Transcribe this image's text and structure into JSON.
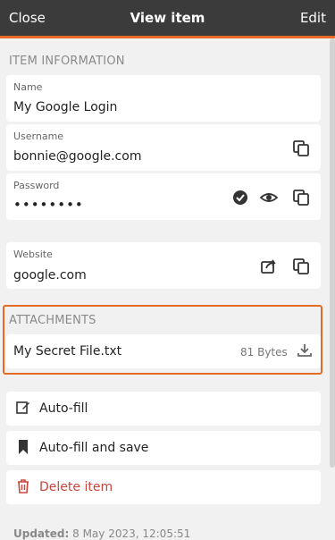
{
  "header": {
    "close_label": "Close",
    "title": "View item",
    "edit_label": "Edit"
  },
  "item_info": {
    "heading": "ITEM INFORMATION",
    "name": {
      "label": "Name",
      "value": "My Google Login"
    },
    "username": {
      "label": "Username",
      "value": "bonnie@google.com"
    },
    "password": {
      "label": "Password",
      "value": "••••••••"
    },
    "website": {
      "label": "Website",
      "value": "google.com"
    }
  },
  "attachments": {
    "heading": "ATTACHMENTS",
    "items": [
      {
        "name": "My Secret File.txt",
        "size": "81 Bytes"
      }
    ]
  },
  "actions": {
    "autofill": "Auto-fill",
    "autofill_save": "Auto-fill and save",
    "delete": "Delete item"
  },
  "footer": {
    "updated_label": "Updated:",
    "updated_value": "8 May 2023, 12:05:51"
  },
  "colors": {
    "accent": "#e56a26",
    "danger": "#c9463d",
    "header_bg": "#3b3b3b"
  },
  "icons": [
    "copy-icon",
    "check-circle-icon",
    "eye-icon",
    "share-icon",
    "download-icon",
    "edit-icon",
    "bookmark-icon",
    "trash-icon"
  ]
}
